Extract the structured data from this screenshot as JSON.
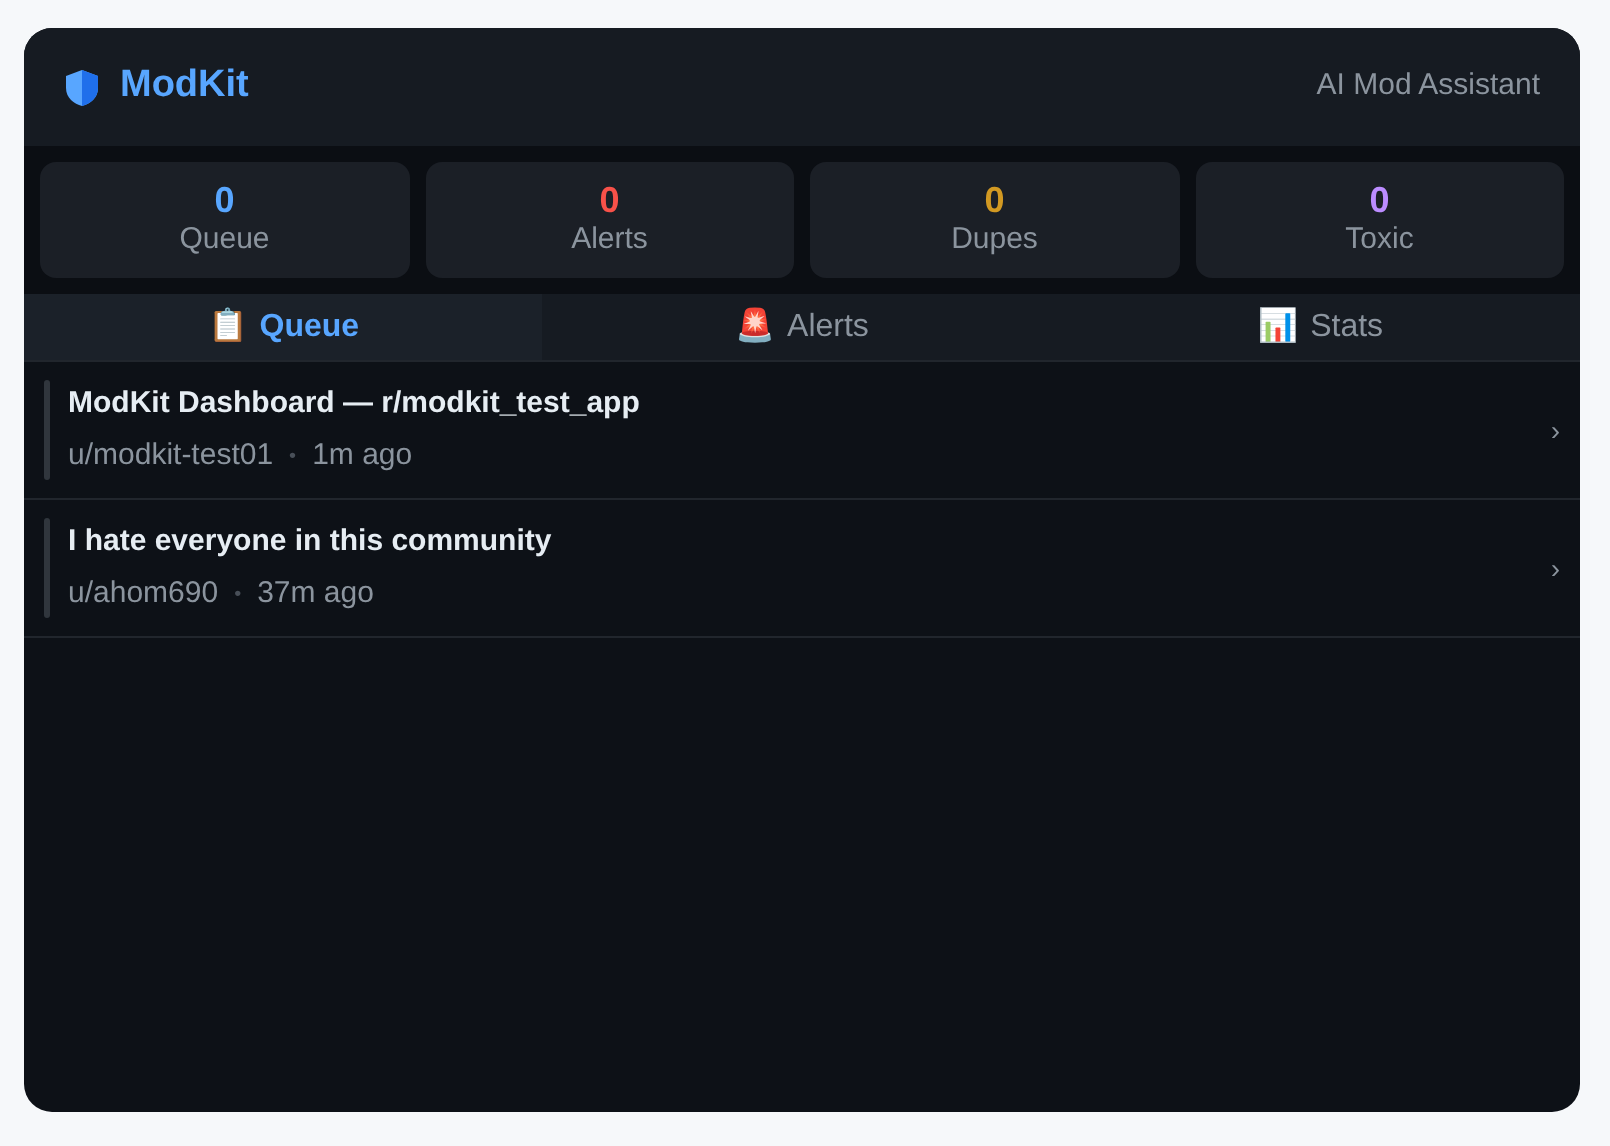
{
  "header": {
    "title": "ModKit",
    "subtitle": "AI Mod Assistant"
  },
  "stats": [
    {
      "value": "0",
      "label": "Queue",
      "color": "#58a6ff"
    },
    {
      "value": "0",
      "label": "Alerts",
      "color": "#f85149"
    },
    {
      "value": "0",
      "label": "Dupes",
      "color": "#d29922"
    },
    {
      "value": "0",
      "label": "Toxic",
      "color": "#bc8cff"
    }
  ],
  "tabs": [
    {
      "icon": "📋",
      "label": "Queue",
      "selected": true
    },
    {
      "icon": "🚨",
      "label": "Alerts",
      "selected": false
    },
    {
      "icon": "📊",
      "label": "Stats",
      "selected": false
    }
  ],
  "queue": [
    {
      "title": "ModKit Dashboard — r/modkit_test_app",
      "author": "u/modkit-test01",
      "separator": "•",
      "time": "1m ago",
      "chevron": "›"
    },
    {
      "title": "I hate everyone in this community",
      "author": "u/ahom690",
      "separator": "•",
      "time": "37m ago",
      "chevron": "›"
    }
  ]
}
